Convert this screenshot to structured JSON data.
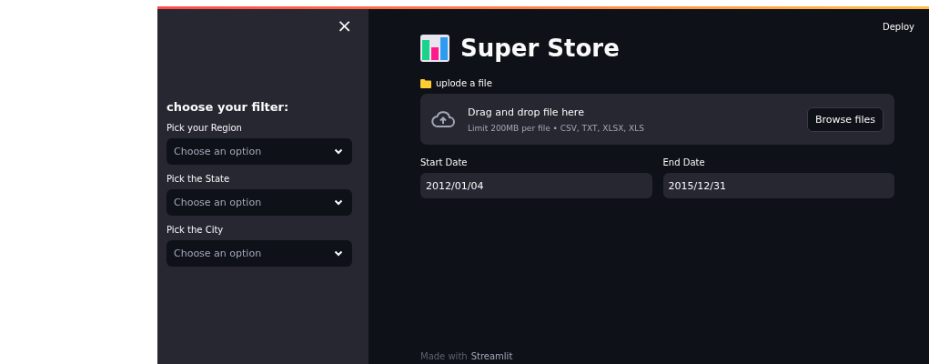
{
  "sidebar": {
    "close": "×",
    "title": "choose your filter:",
    "filters": [
      {
        "label": "Pick your Region",
        "placeholder": "Choose an option"
      },
      {
        "label": "Pick the State",
        "placeholder": "Choose an option"
      },
      {
        "label": "Pick the City",
        "placeholder": "Choose an option"
      }
    ]
  },
  "header": {
    "deploy": "Deploy"
  },
  "title": "Super Store",
  "uploader": {
    "label": "uplode a file",
    "instruction": "Drag and drop file here",
    "limit": "Limit 200MB per file • CSV, TXT, XLSX, XLS",
    "button": "Browse files"
  },
  "dates": [
    {
      "label": "Start Date",
      "value": "2012/01/04"
    },
    {
      "label": "End Date",
      "value": "2015/12/31"
    }
  ],
  "footer": {
    "made_with": "Made with",
    "brand": "Streamlit"
  }
}
